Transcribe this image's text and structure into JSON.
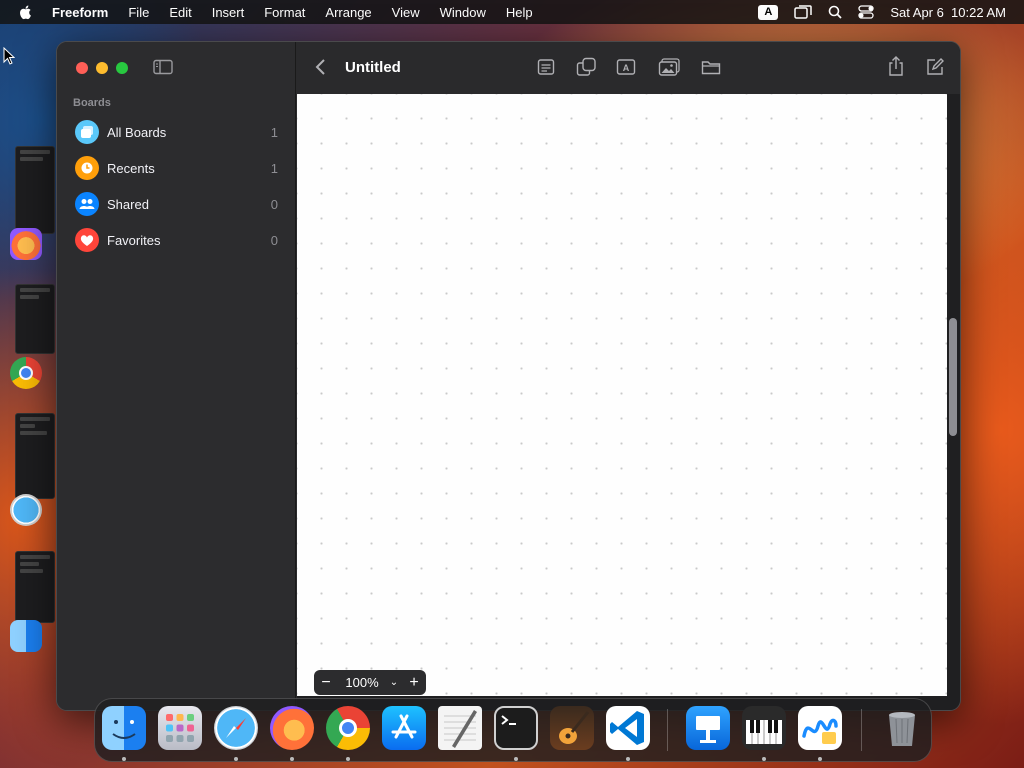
{
  "menubar": {
    "app_name": "Freeform",
    "items": [
      "File",
      "Edit",
      "Insert",
      "Format",
      "Arrange",
      "View",
      "Window",
      "Help"
    ],
    "input_badge": "A",
    "datetime": "Sat Apr 6  10:22 AM"
  },
  "window": {
    "sidebar": {
      "section_label": "Boards",
      "items": [
        {
          "label": "All Boards",
          "count": "1",
          "icon": "boards-icon",
          "color": "#5ac8fa"
        },
        {
          "label": "Recents",
          "count": "1",
          "icon": "clock-icon",
          "color": "#ff9f0a"
        },
        {
          "label": "Shared",
          "count": "0",
          "icon": "people-icon",
          "color": "#0a84ff"
        },
        {
          "label": "Favorites",
          "count": "0",
          "icon": "heart-icon",
          "color": "#ff453a"
        }
      ]
    },
    "toolbar": {
      "title": "Untitled",
      "tools": [
        "sticky-note-icon",
        "shapes-icon",
        "text-box-icon",
        "media-icon",
        "file-icon",
        "share-icon",
        "compose-icon"
      ]
    },
    "zoom": {
      "minus": "−",
      "value": "100%",
      "plus": "+"
    }
  },
  "dock": {
    "apps": [
      "Finder",
      "Launchpad",
      "Safari",
      "Firefox",
      "Chrome",
      "App Store",
      "TextEdit",
      "Terminal",
      "GarageBand",
      "Visual Studio Code",
      "Keynote",
      "Piano",
      "Freeform",
      "Trash"
    ]
  },
  "colors": {
    "close": "#ff5f57",
    "minimize": "#febc2e",
    "zoom": "#28c840"
  }
}
